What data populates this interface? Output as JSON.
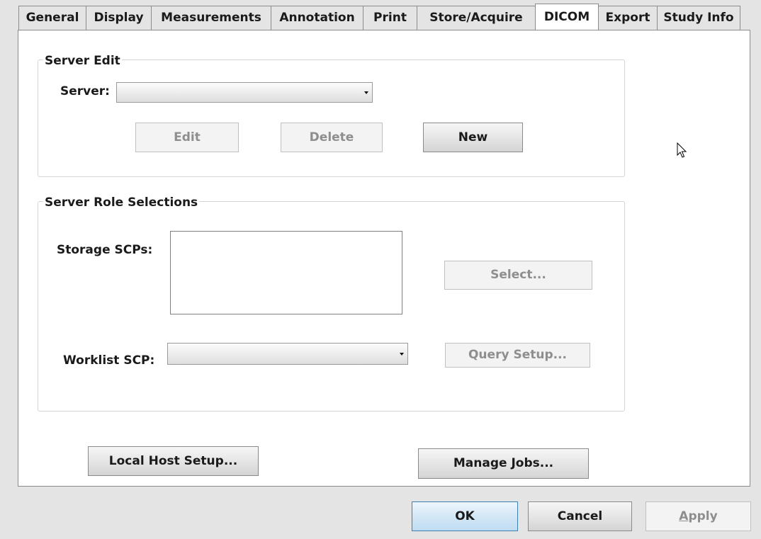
{
  "tabs": [
    {
      "label": "General",
      "active": false
    },
    {
      "label": "Display",
      "active": false
    },
    {
      "label": "Measurements",
      "active": false
    },
    {
      "label": "Annotation",
      "active": false
    },
    {
      "label": "Print",
      "active": false
    },
    {
      "label": "Store/Acquire",
      "active": false
    },
    {
      "label": "DICOM",
      "active": true
    },
    {
      "label": "Export",
      "active": false
    },
    {
      "label": "Study Info",
      "active": false
    }
  ],
  "server_edit": {
    "legend": "Server Edit",
    "server_label": "Server:",
    "server_value": "",
    "edit_label": "Edit",
    "delete_label": "Delete",
    "new_label": "New"
  },
  "server_roles": {
    "legend": "Server Role Selections",
    "storage_label": "Storage SCPs:",
    "storage_items": [],
    "select_label": "Select...",
    "worklist_label": "Worklist SCP:",
    "worklist_value": "",
    "query_setup_label": "Query Setup..."
  },
  "local_host_setup_label": "Local Host Setup...",
  "manage_jobs_label": "Manage Jobs...",
  "dialog": {
    "ok_label": "OK",
    "cancel_label": "Cancel",
    "apply_label_rest": "pply",
    "apply_mnemonic": "A"
  },
  "icons": {
    "combo_arrow": "chevron-down-icon",
    "cursor": "mouse-pointer-icon"
  },
  "colors": {
    "default_button_border": "#3c7fb1",
    "disabled_text": "#8e8e8e"
  }
}
